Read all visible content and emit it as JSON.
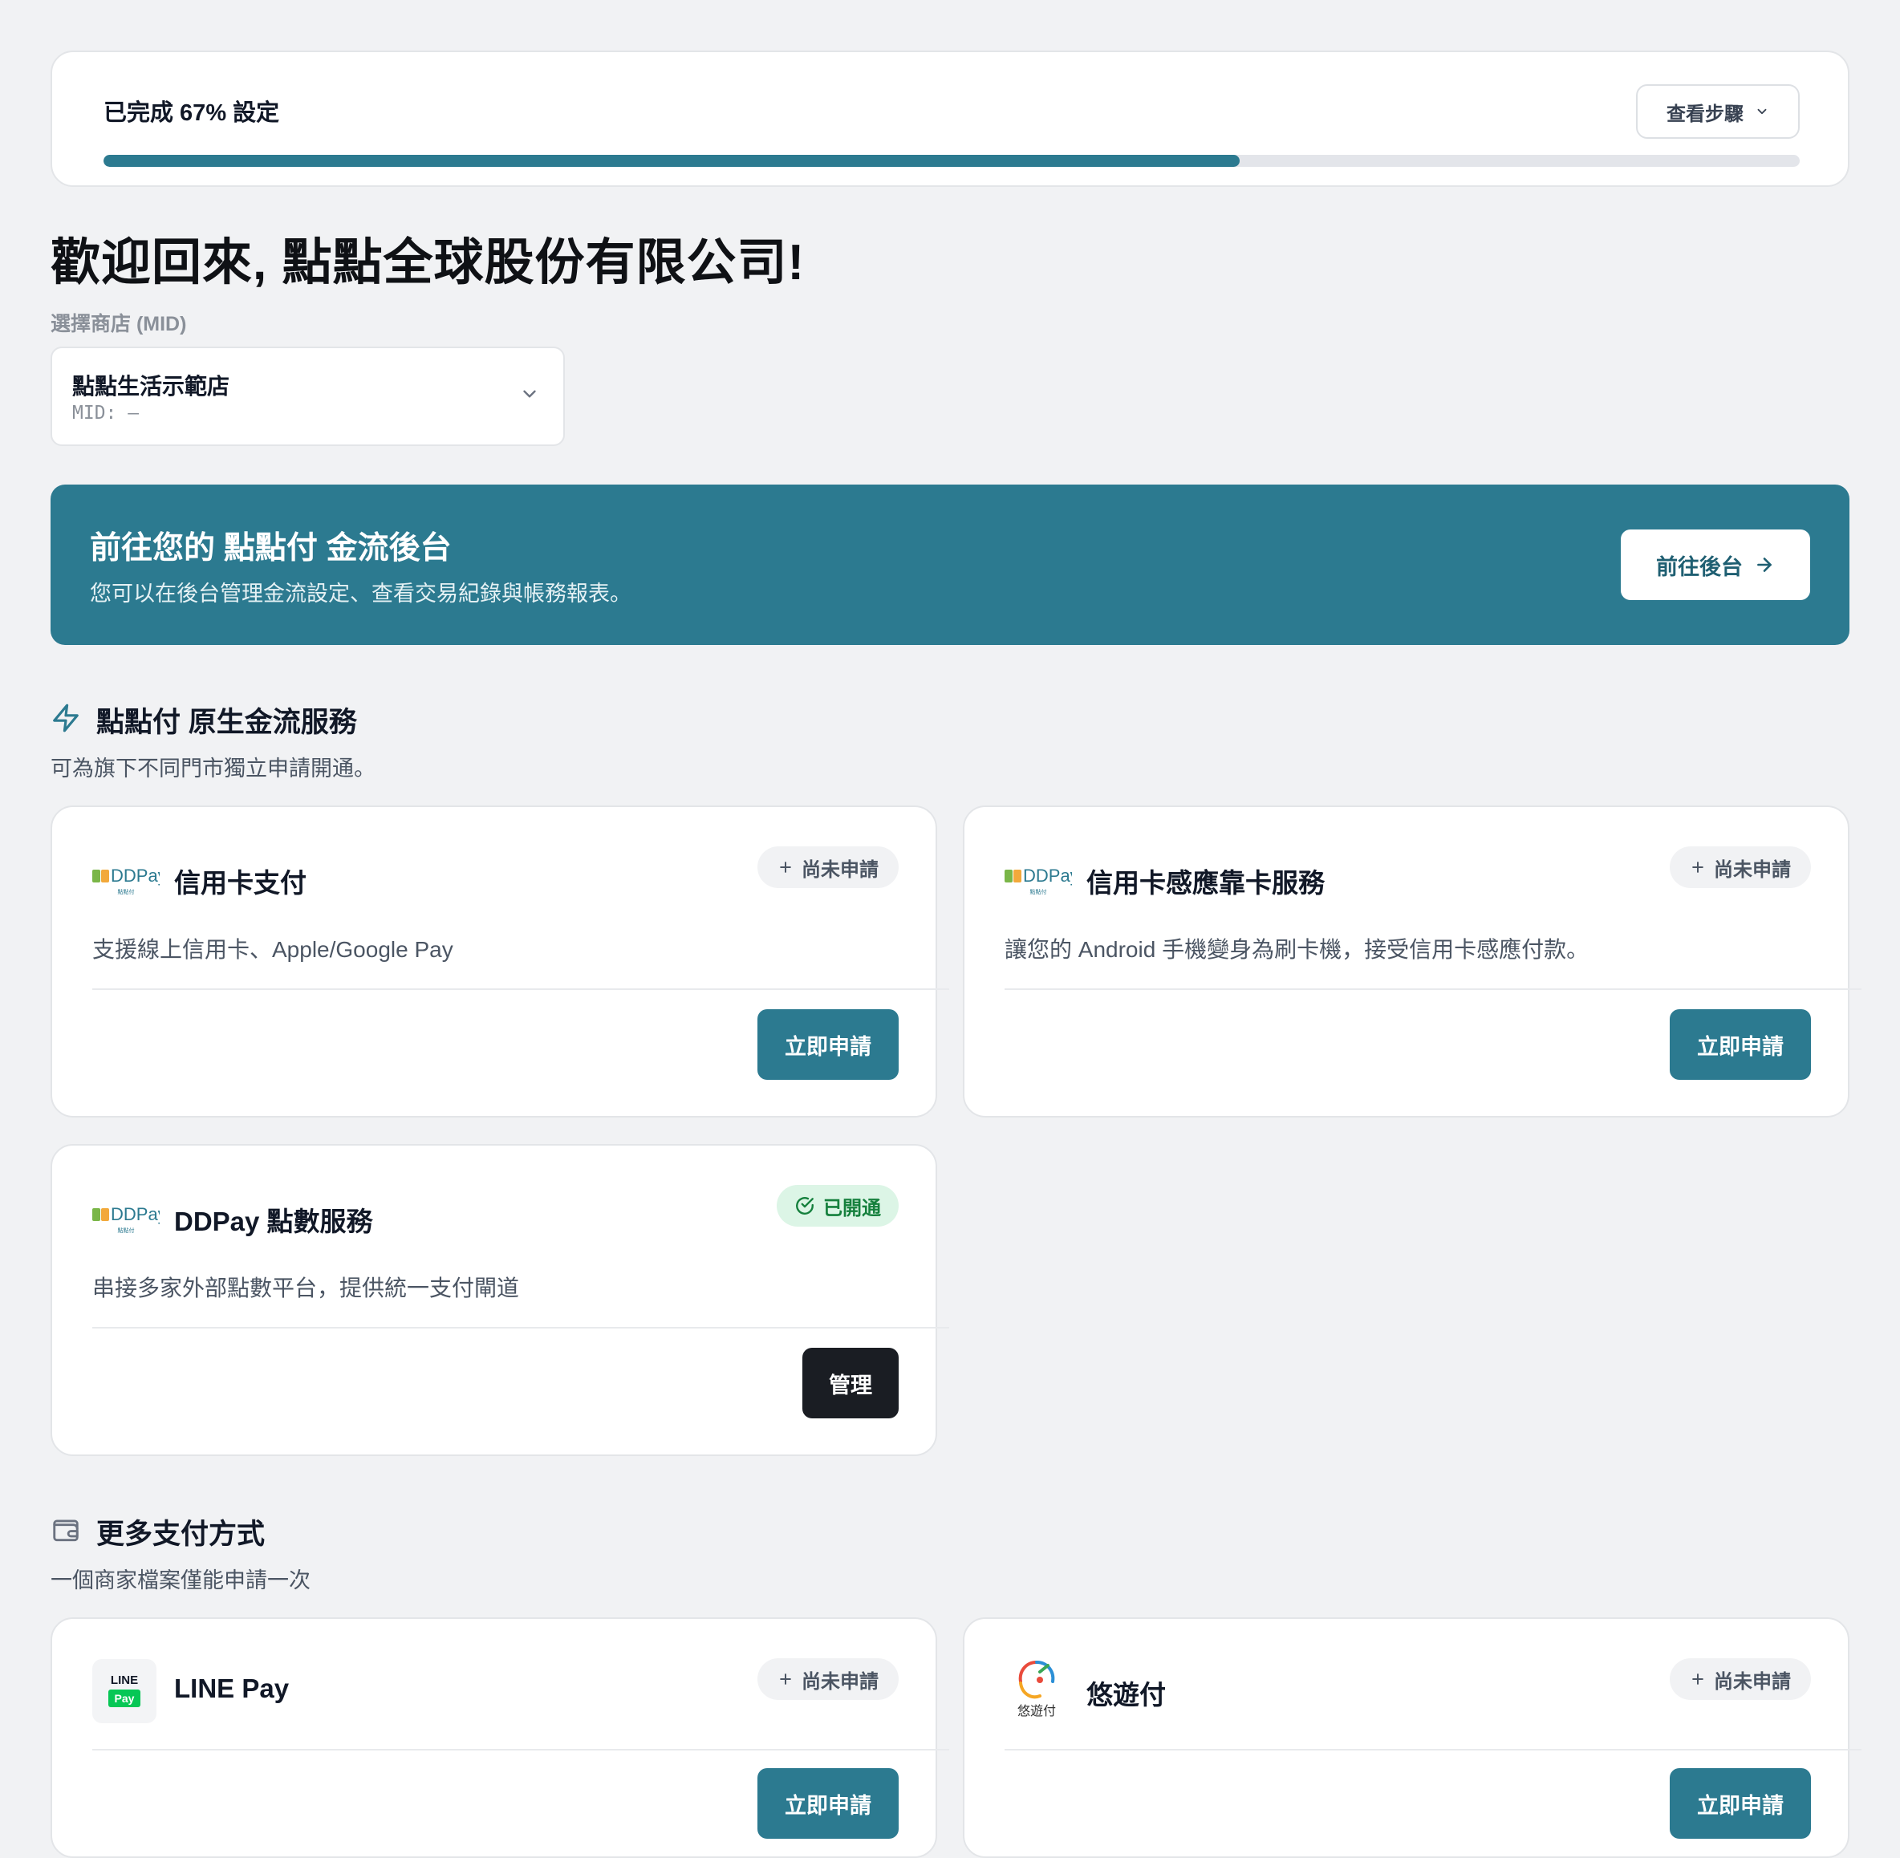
{
  "progress": {
    "label": "已完成 67% 設定",
    "percent": 67,
    "steps_button": "查看步驟"
  },
  "welcome": {
    "title": "歡迎回來, 點點全球股份有限公司!"
  },
  "store": {
    "label": "選擇商店 (MID)",
    "name": "點點生活示範店",
    "mid": "MID: –"
  },
  "banner": {
    "title": "前往您的 點點付 金流後台",
    "subtitle": "您可以在後台管理金流設定、查看交易紀錄與帳務報表。",
    "button": "前往後台"
  },
  "native_section": {
    "title": "點點付 原生金流服務",
    "subtitle": "可為旗下不同門市獨立申請開通。",
    "cards": [
      {
        "logo_text": "DDPay",
        "logo_sub": "點點付",
        "title": "信用卡支付",
        "status": "尚未申請",
        "desc": "支援線上信用卡、Apple/Google Pay",
        "action": "立即申請"
      },
      {
        "logo_text": "DDPay",
        "logo_sub": "點點付",
        "title": "信用卡感應靠卡服務",
        "status": "尚未申請",
        "desc": "讓您的 Android 手機變身為刷卡機，接受信用卡感應付款。",
        "action": "立即申請"
      },
      {
        "logo_text": "DDPay",
        "logo_sub": "點點付",
        "title": "DDPay 點數服務",
        "status": "已開通",
        "desc": "串接多家外部點數平台，提供統一支付閘道",
        "action": "管理"
      }
    ]
  },
  "more_section": {
    "title": "更多支付方式",
    "subtitle": "一個商家檔案僅能申請一次",
    "cards": [
      {
        "logo_line1": "LINE",
        "logo_line2": "Pay",
        "title": "LINE Pay",
        "status": "尚未申請",
        "action": "立即申請"
      },
      {
        "logo_text": "悠遊付",
        "title": "悠遊付",
        "status": "尚未申請",
        "action": "立即申請"
      }
    ]
  },
  "colors": {
    "primary": "#2c7a90",
    "background": "#f1f2f4",
    "success": "#15803d",
    "dark_button": "#1a1d23"
  }
}
